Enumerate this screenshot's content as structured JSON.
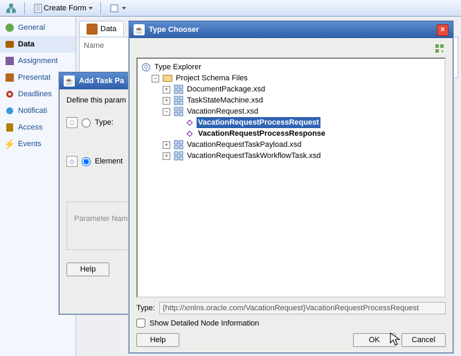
{
  "toolbar": {
    "create_form_label": "Create Form"
  },
  "sidebar": {
    "items": [
      {
        "label": "General"
      },
      {
        "label": "Data"
      },
      {
        "label": "Assignment"
      },
      {
        "label": "Presentat"
      },
      {
        "label": "Deadlines"
      },
      {
        "label": "Notificati"
      },
      {
        "label": "Access"
      },
      {
        "label": "Events"
      }
    ]
  },
  "content": {
    "tab_label": "Data",
    "name_header": "Name"
  },
  "add_modal": {
    "title": "Add Task Pa",
    "define": "Define this param",
    "type_label": "Type:",
    "element_label": "Element",
    "param_label": "Parameter Name",
    "help": "Help"
  },
  "type_chooser": {
    "title": "Type Chooser",
    "tree": {
      "root": "Type Explorer",
      "project_folder": "Project Schema Files",
      "files": [
        {
          "label": "DocumentPackage.xsd",
          "exp": "+"
        },
        {
          "label": "TaskStateMachine.xsd",
          "exp": "+"
        },
        {
          "label": "VacationRequest.xsd",
          "exp": "-",
          "children": [
            {
              "label": "VacationRequestProcessRequest",
              "selected": true,
              "bold": true
            },
            {
              "label": "VacationRequestProcessResponse",
              "bold": true
            }
          ]
        },
        {
          "label": "VacationRequestTaskPayload.xsd",
          "exp": "+"
        },
        {
          "label": "VacationRequestTaskWorkflowTask.xsd",
          "exp": "+"
        }
      ]
    },
    "type_label": "Type:",
    "type_value": "{http://xmlns.oracle.com/VacationRequest}VacationRequestProcessRequest",
    "show_detail": "Show Detailed Node Information",
    "help": "Help",
    "ok": "OK",
    "cancel": "Cancel"
  }
}
